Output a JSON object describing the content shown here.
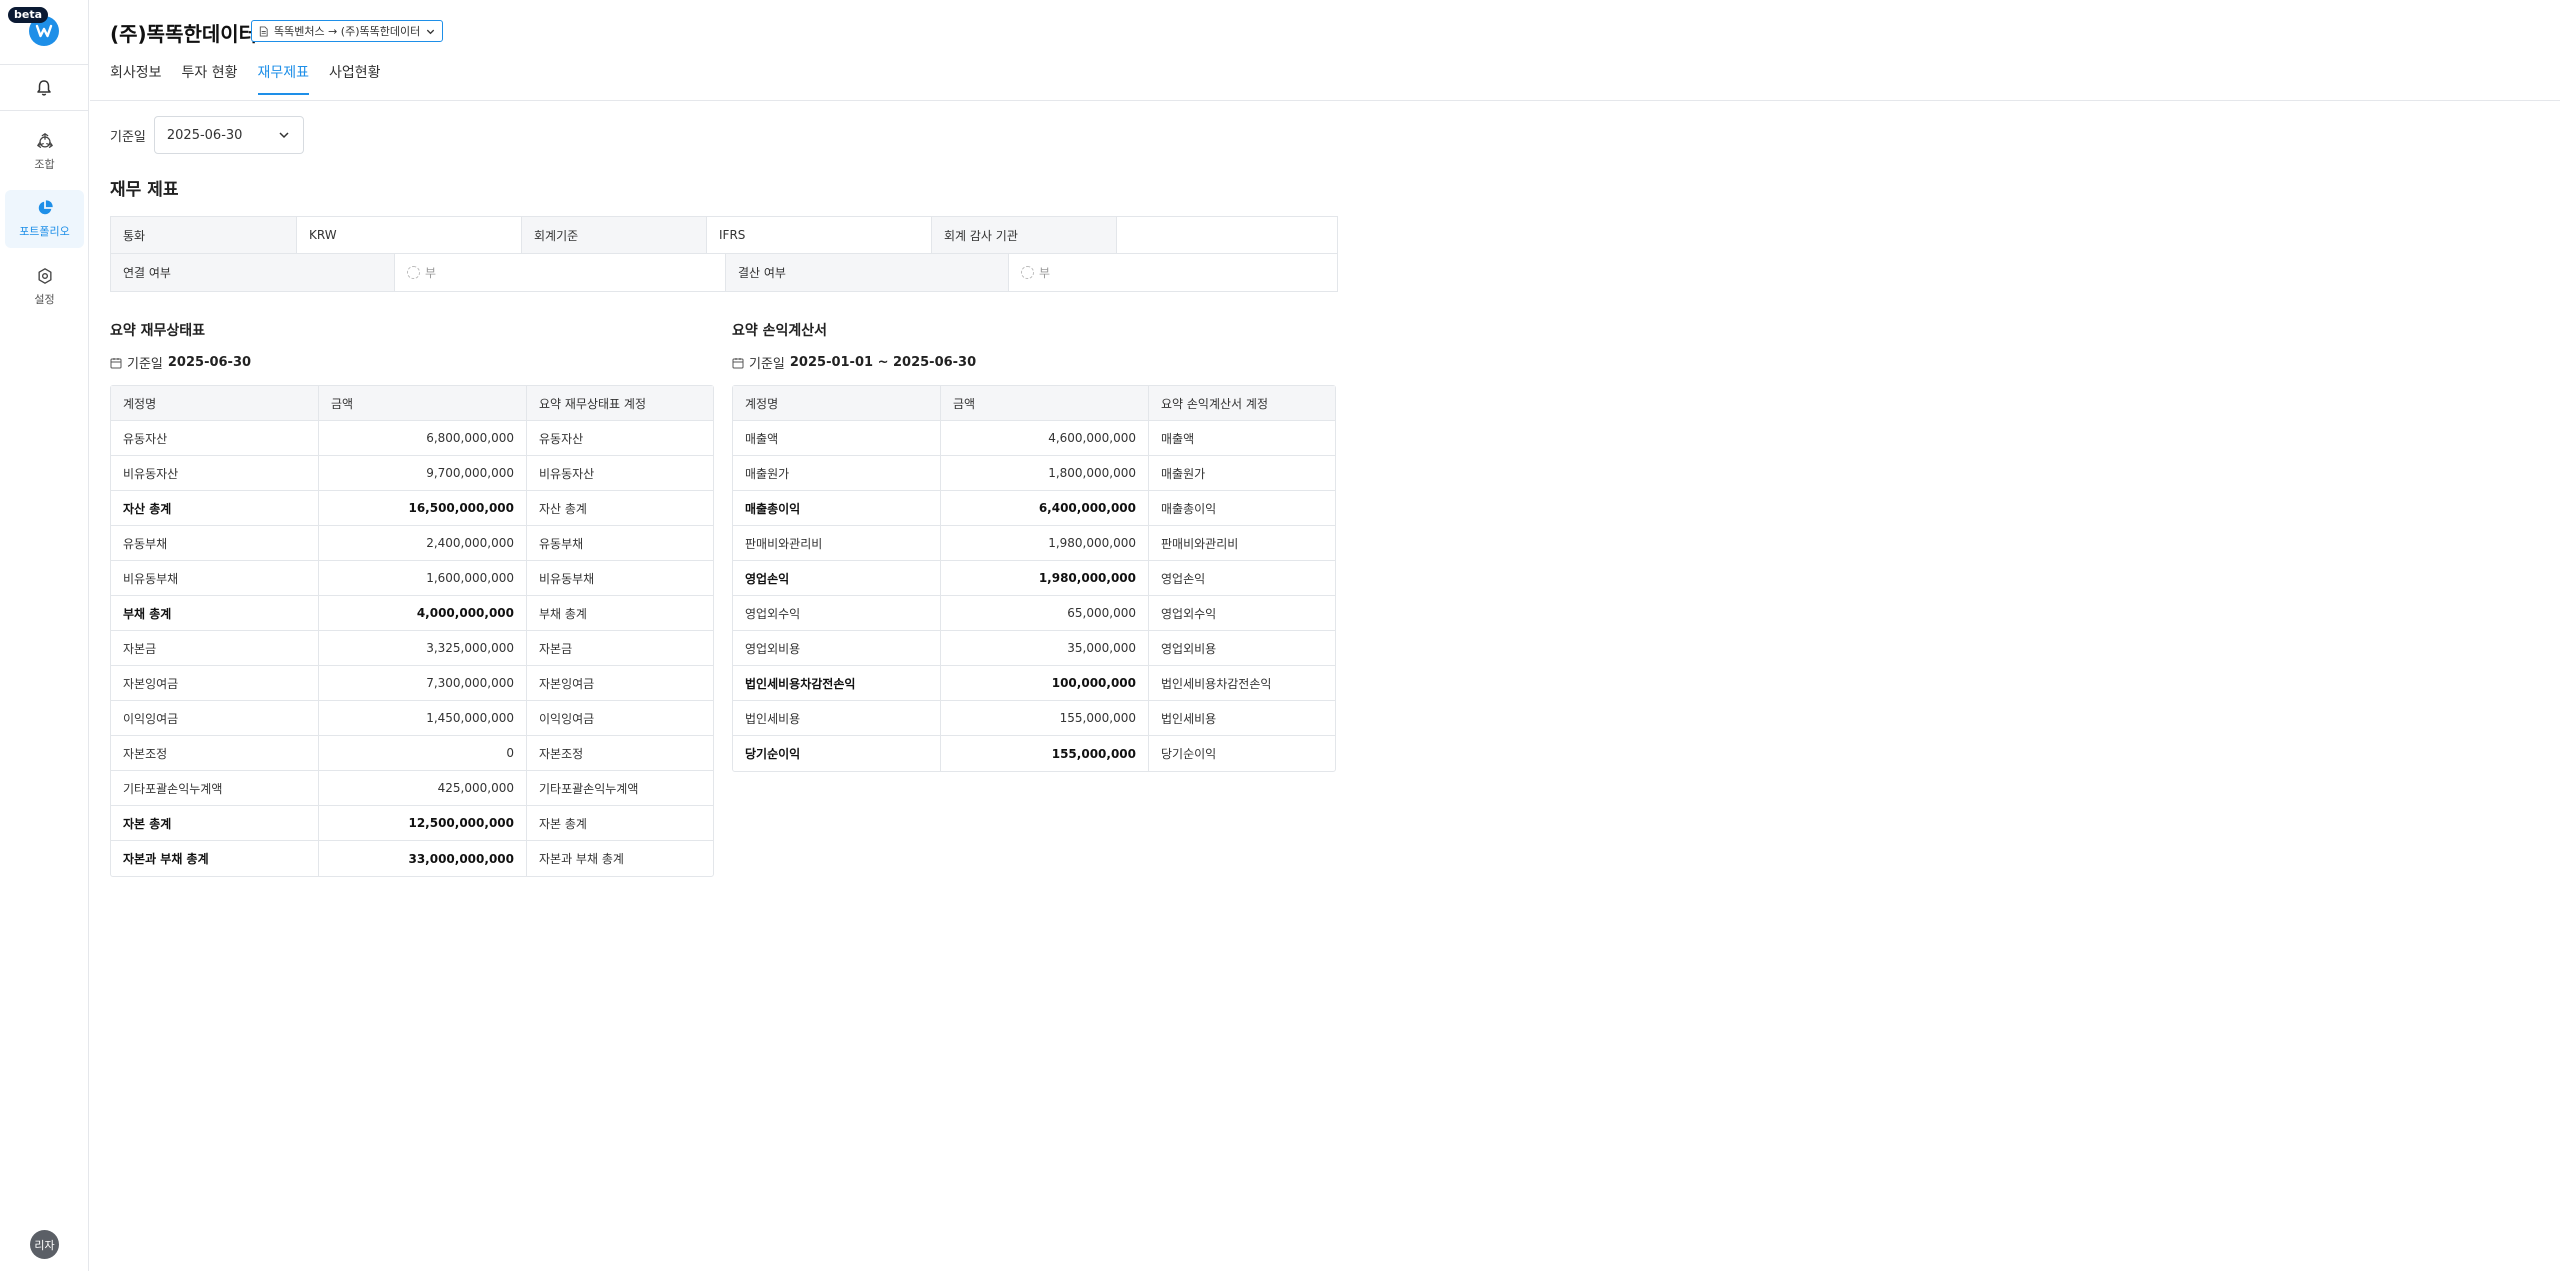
{
  "sidebar": {
    "beta_badge": "beta",
    "items": [
      {
        "label": "조합",
        "icon": "recycle-icon"
      },
      {
        "label": "포트폴리오",
        "icon": "pie-chart-icon"
      },
      {
        "label": "설정",
        "icon": "gear-icon"
      }
    ],
    "avatar_text": "리자"
  },
  "header": {
    "title": "(주)똑똑한데이터",
    "path_chip": "똑똑벤처스 → (주)똑똑한데이터",
    "tabs": [
      "회사정보",
      "투자 현황",
      "재무제표",
      "사업현황"
    ],
    "active_tab": "재무제표"
  },
  "filter": {
    "date_label": "기준일",
    "date_value": "2025-06-30"
  },
  "section_title": "재무 제표",
  "info": {
    "currency_label": "통화",
    "currency_value": "KRW",
    "standard_label": "회계기준",
    "standard_value": "IFRS",
    "auditor_label": "회계 감사 기관",
    "auditor_value": "",
    "consolidated_label": "연결 여부",
    "consolidated_value": "부",
    "settlement_label": "결산 여부",
    "settlement_value": "부"
  },
  "balance_sheet": {
    "title": "요약 재무상태표",
    "date_prefix": "기준일",
    "date": "2025-06-30",
    "headers": [
      "계정명",
      "금액",
      "요약 재무상태표 계정"
    ],
    "rows": [
      {
        "name": "유동자산",
        "amount": "6,800,000,000",
        "account": "유동자산",
        "bold": false
      },
      {
        "name": "비유동자산",
        "amount": "9,700,000,000",
        "account": "비유동자산",
        "bold": false
      },
      {
        "name": "자산 총계",
        "amount": "16,500,000,000",
        "account": "자산 총계",
        "bold": true
      },
      {
        "name": "유동부채",
        "amount": "2,400,000,000",
        "account": "유동부채",
        "bold": false
      },
      {
        "name": "비유동부채",
        "amount": "1,600,000,000",
        "account": "비유동부채",
        "bold": false
      },
      {
        "name": "부채 총계",
        "amount": "4,000,000,000",
        "account": "부채 총계",
        "bold": true
      },
      {
        "name": "자본금",
        "amount": "3,325,000,000",
        "account": "자본금",
        "bold": false
      },
      {
        "name": "자본잉여금",
        "amount": "7,300,000,000",
        "account": "자본잉여금",
        "bold": false
      },
      {
        "name": "이익잉여금",
        "amount": "1,450,000,000",
        "account": "이익잉여금",
        "bold": false
      },
      {
        "name": "자본조정",
        "amount": "0",
        "account": "자본조정",
        "bold": false
      },
      {
        "name": "기타포괄손익누계액",
        "amount": "425,000,000",
        "account": "기타포괄손익누계액",
        "bold": false
      },
      {
        "name": "자본 총계",
        "amount": "12,500,000,000",
        "account": "자본 총계",
        "bold": true
      },
      {
        "name": "자본과 부채 총계",
        "amount": "33,000,000,000",
        "account": "자본과 부채 총계",
        "bold": true
      }
    ]
  },
  "income_statement": {
    "title": "요약 손익계산서",
    "date_prefix": "기준일",
    "date": "2025-01-01 ~ 2025-06-30",
    "headers": [
      "계정명",
      "금액",
      "요약 손익계산서 계정"
    ],
    "rows": [
      {
        "name": "매출액",
        "amount": "4,600,000,000",
        "account": "매출액",
        "bold": false
      },
      {
        "name": "매출원가",
        "amount": "1,800,000,000",
        "account": "매출원가",
        "bold": false
      },
      {
        "name": "매출총이익",
        "amount": "6,400,000,000",
        "account": "매출총이익",
        "bold": true
      },
      {
        "name": "판매비와관리비",
        "amount": "1,980,000,000",
        "account": "판매비와관리비",
        "bold": false
      },
      {
        "name": "영업손익",
        "amount": "1,980,000,000",
        "account": "영업손익",
        "bold": true
      },
      {
        "name": "영업외수익",
        "amount": "65,000,000",
        "account": "영업외수익",
        "bold": false
      },
      {
        "name": "영업외비용",
        "amount": "35,000,000",
        "account": "영업외비용",
        "bold": false
      },
      {
        "name": "법인세비용차감전손익",
        "amount": "100,000,000",
        "account": "법인세비용차감전손익",
        "bold": true
      },
      {
        "name": "법인세비용",
        "amount": "155,000,000",
        "account": "법인세비용",
        "bold": false
      },
      {
        "name": "당기순이익",
        "amount": "155,000,000",
        "account": "당기순이익",
        "bold": true
      }
    ]
  }
}
